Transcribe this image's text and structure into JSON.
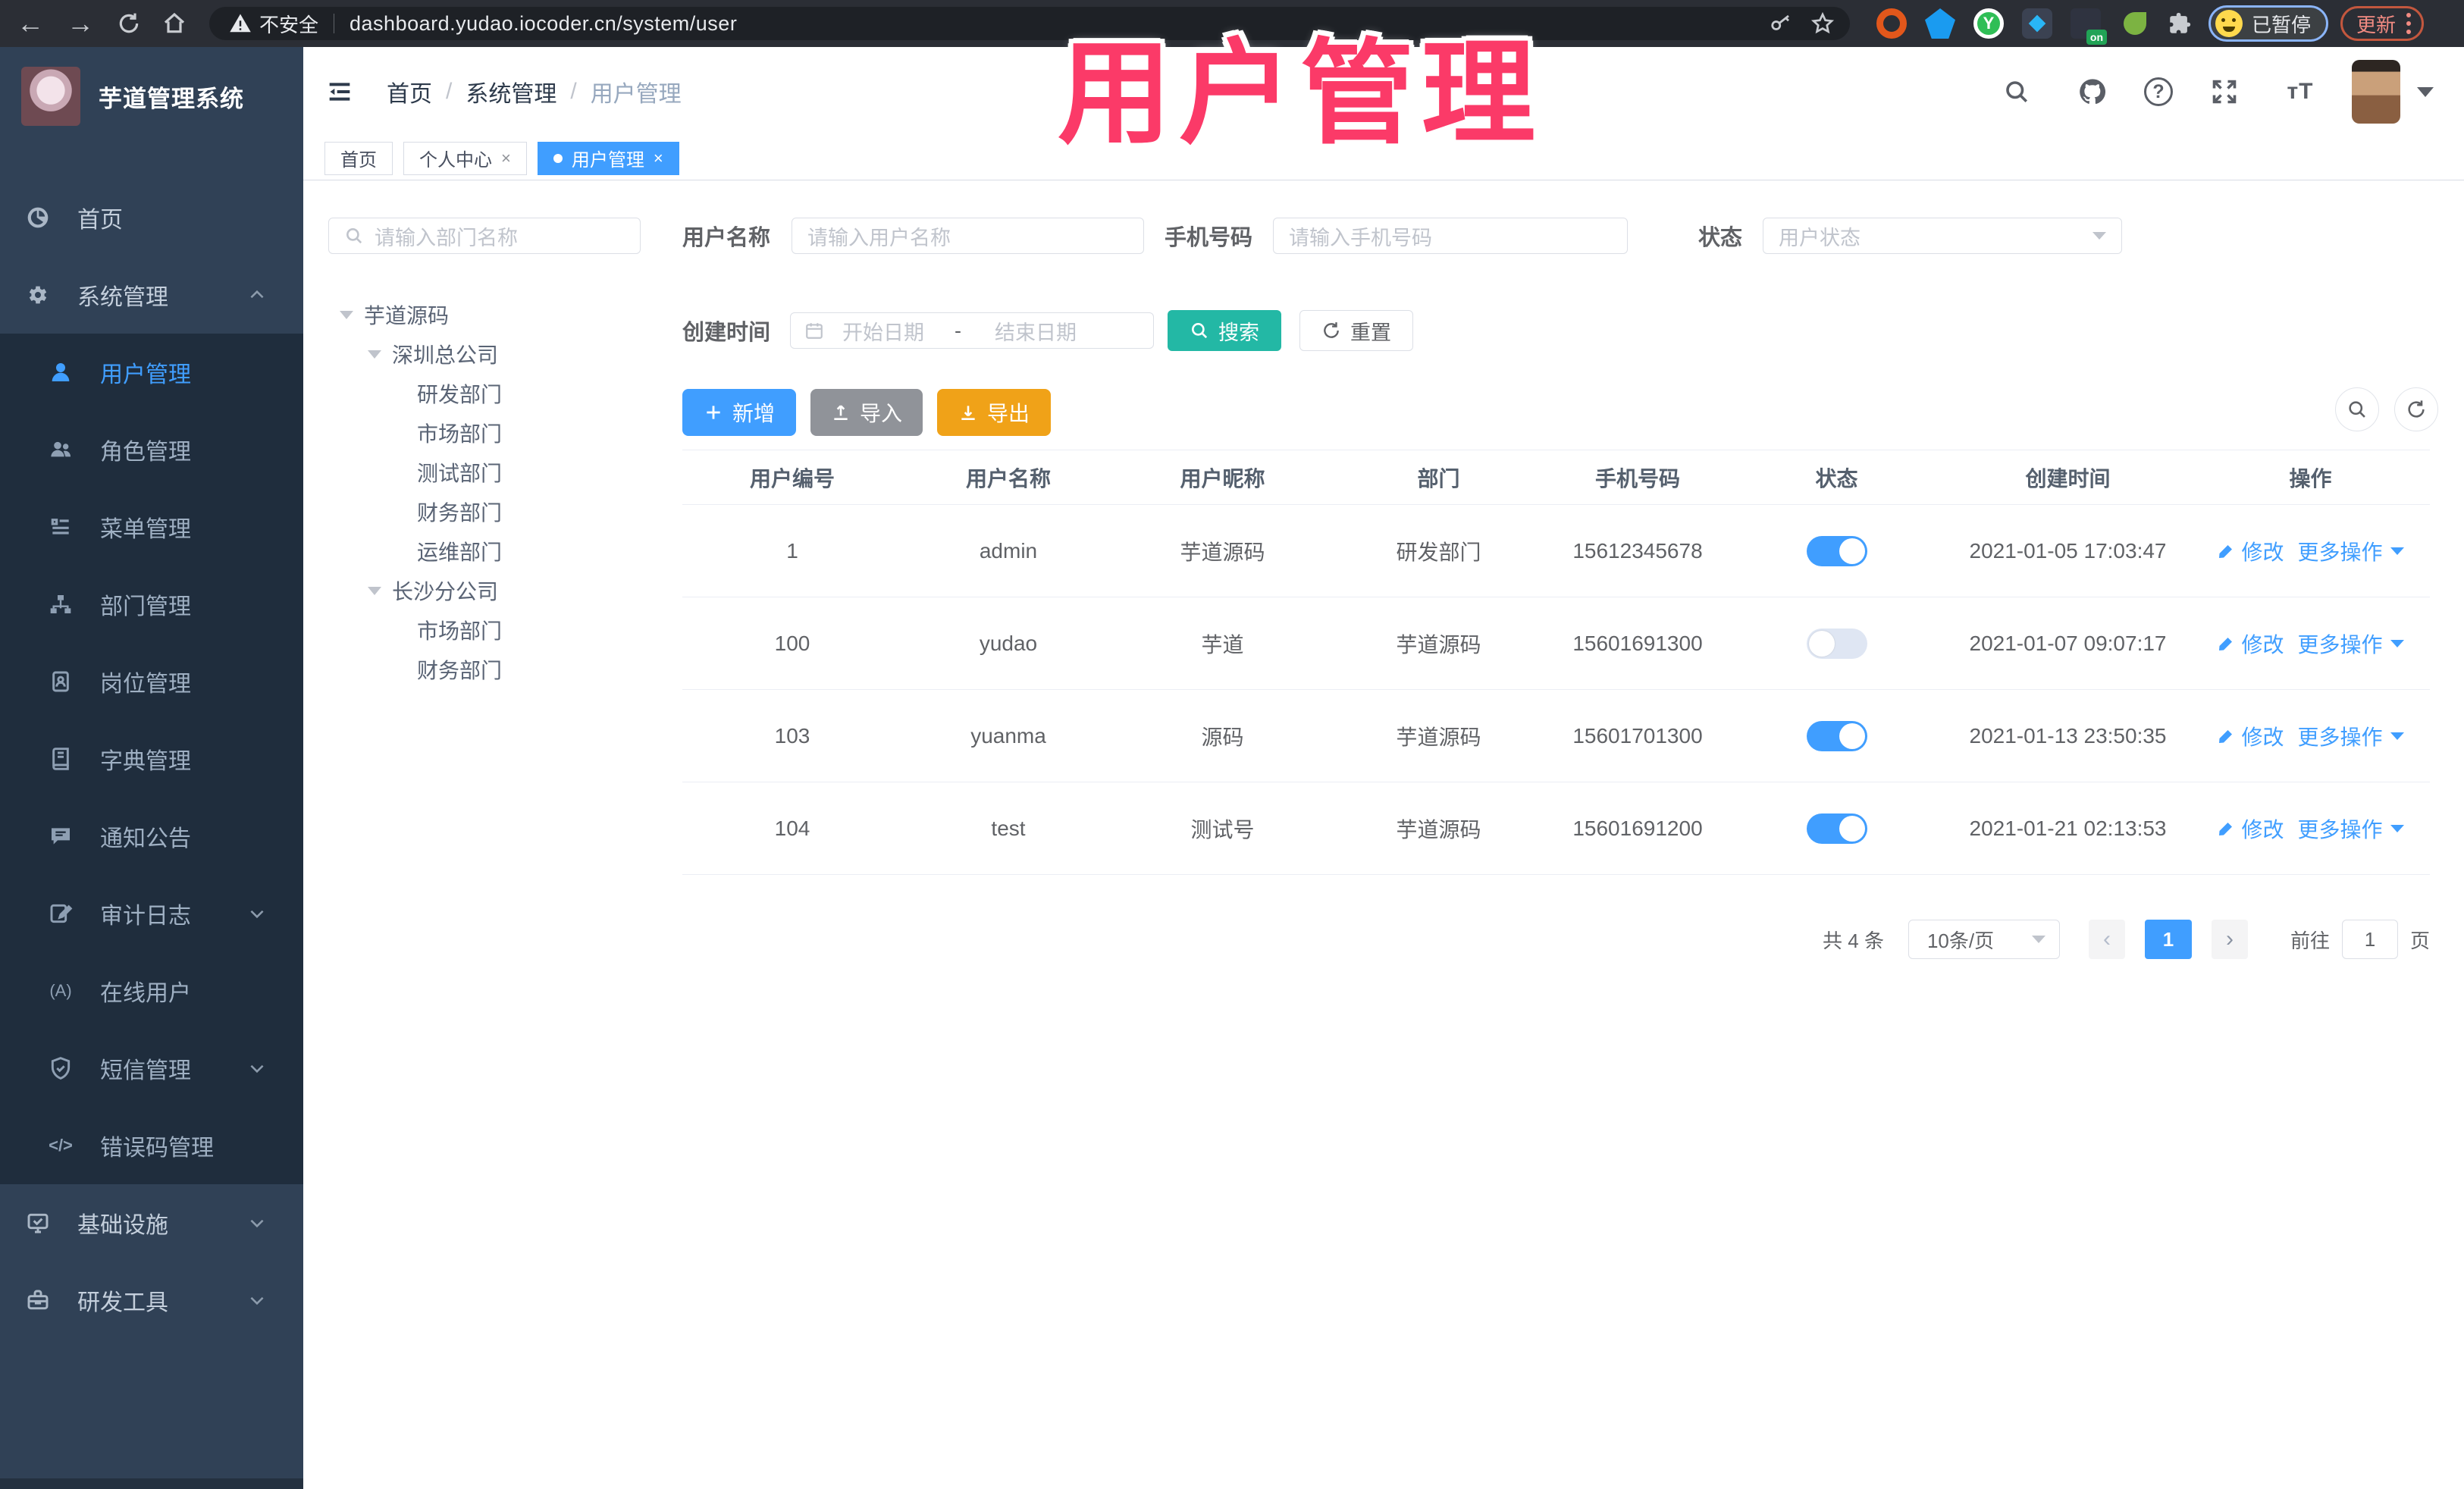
{
  "watermark": "用户管理",
  "browser": {
    "insecure_label": "不安全",
    "url_host": "dashboard.yudao.iocoder.cn",
    "url_path": "/system/user",
    "profile_status": "已暂停",
    "update_label": "更新",
    "ext_on_badge": "on",
    "ext_green_letter": "Y"
  },
  "header": {
    "logo_title": "芋道管理系统",
    "breadcrumb": {
      "home": "首页",
      "group": "系统管理",
      "current": "用户管理"
    },
    "help_icon_text": "?",
    "font_icon_text": "тT"
  },
  "tabs": {
    "home": "首页",
    "profile": "个人中心",
    "user": "用户管理",
    "close_glyph": "×"
  },
  "sidebar": {
    "items": [
      {
        "label": "首页"
      },
      {
        "label": "系统管理"
      },
      {
        "label": "用户管理"
      },
      {
        "label": "角色管理"
      },
      {
        "label": "菜单管理"
      },
      {
        "label": "部门管理"
      },
      {
        "label": "岗位管理"
      },
      {
        "label": "字典管理"
      },
      {
        "label": "通知公告"
      },
      {
        "label": "审计日志"
      },
      {
        "label": "在线用户"
      },
      {
        "label": "短信管理"
      },
      {
        "label": "错误码管理"
      },
      {
        "label": "基础设施"
      },
      {
        "label": "研发工具"
      }
    ],
    "online_icon_text": "(A)",
    "errcode_icon_text": "</>"
  },
  "dept": {
    "search_placeholder": "请输入部门名称",
    "tree": [
      {
        "label": "芋道源码"
      },
      {
        "label": "深圳总公司"
      },
      {
        "label": "研发部门"
      },
      {
        "label": "市场部门"
      },
      {
        "label": "测试部门"
      },
      {
        "label": "财务部门"
      },
      {
        "label": "运维部门"
      },
      {
        "label": "长沙分公司"
      },
      {
        "label": "市场部门"
      },
      {
        "label": "财务部门"
      }
    ]
  },
  "filters": {
    "username_label": "用户名称",
    "username_placeholder": "请输入用户名称",
    "mobile_label": "手机号码",
    "mobile_placeholder": "请输入手机号码",
    "status_label": "状态",
    "status_placeholder": "用户状态",
    "create_time_label": "创建时间",
    "date_start_placeholder": "开始日期",
    "date_separator": "-",
    "date_end_placeholder": "结束日期",
    "search_label": "搜索",
    "reset_label": "重置"
  },
  "toolbar": {
    "add_label": "新增",
    "import_label": "导入",
    "export_label": "导出"
  },
  "table": {
    "columns": [
      "用户编号",
      "用户名称",
      "用户昵称",
      "部门",
      "手机号码",
      "状态",
      "创建时间",
      "操作"
    ],
    "edit_label": "修改",
    "more_label": "更多操作",
    "rows": [
      {
        "id": "1",
        "username": "admin",
        "nickname": "芋道源码",
        "dept": "研发部门",
        "mobile": "15612345678",
        "status": "on",
        "created": "2021-01-05 17:03:47"
      },
      {
        "id": "100",
        "username": "yudao",
        "nickname": "芋道",
        "dept": "芋道源码",
        "mobile": "15601691300",
        "status": "off",
        "created": "2021-01-07 09:07:17"
      },
      {
        "id": "103",
        "username": "yuanma",
        "nickname": "源码",
        "dept": "芋道源码",
        "mobile": "15601701300",
        "status": "on",
        "created": "2021-01-13 23:50:35"
      },
      {
        "id": "104",
        "username": "test",
        "nickname": "测试号",
        "dept": "芋道源码",
        "mobile": "15601691200",
        "status": "on",
        "created": "2021-01-21 02:13:53"
      }
    ]
  },
  "pagination": {
    "total": "共 4 条",
    "page_size": "10条/页",
    "prev_glyph": "‹",
    "next_glyph": "›",
    "current": "1",
    "goto_label": "前往",
    "goto_value": "1",
    "unit_label": "页"
  },
  "colors": {
    "accent": "#409EFF",
    "sidebar_bg": "#304156",
    "submenu_bg": "#1f2d3d",
    "search_button": "#23b8a5",
    "export_button": "#f0a218",
    "watermark_pink": "#fb3a68"
  }
}
